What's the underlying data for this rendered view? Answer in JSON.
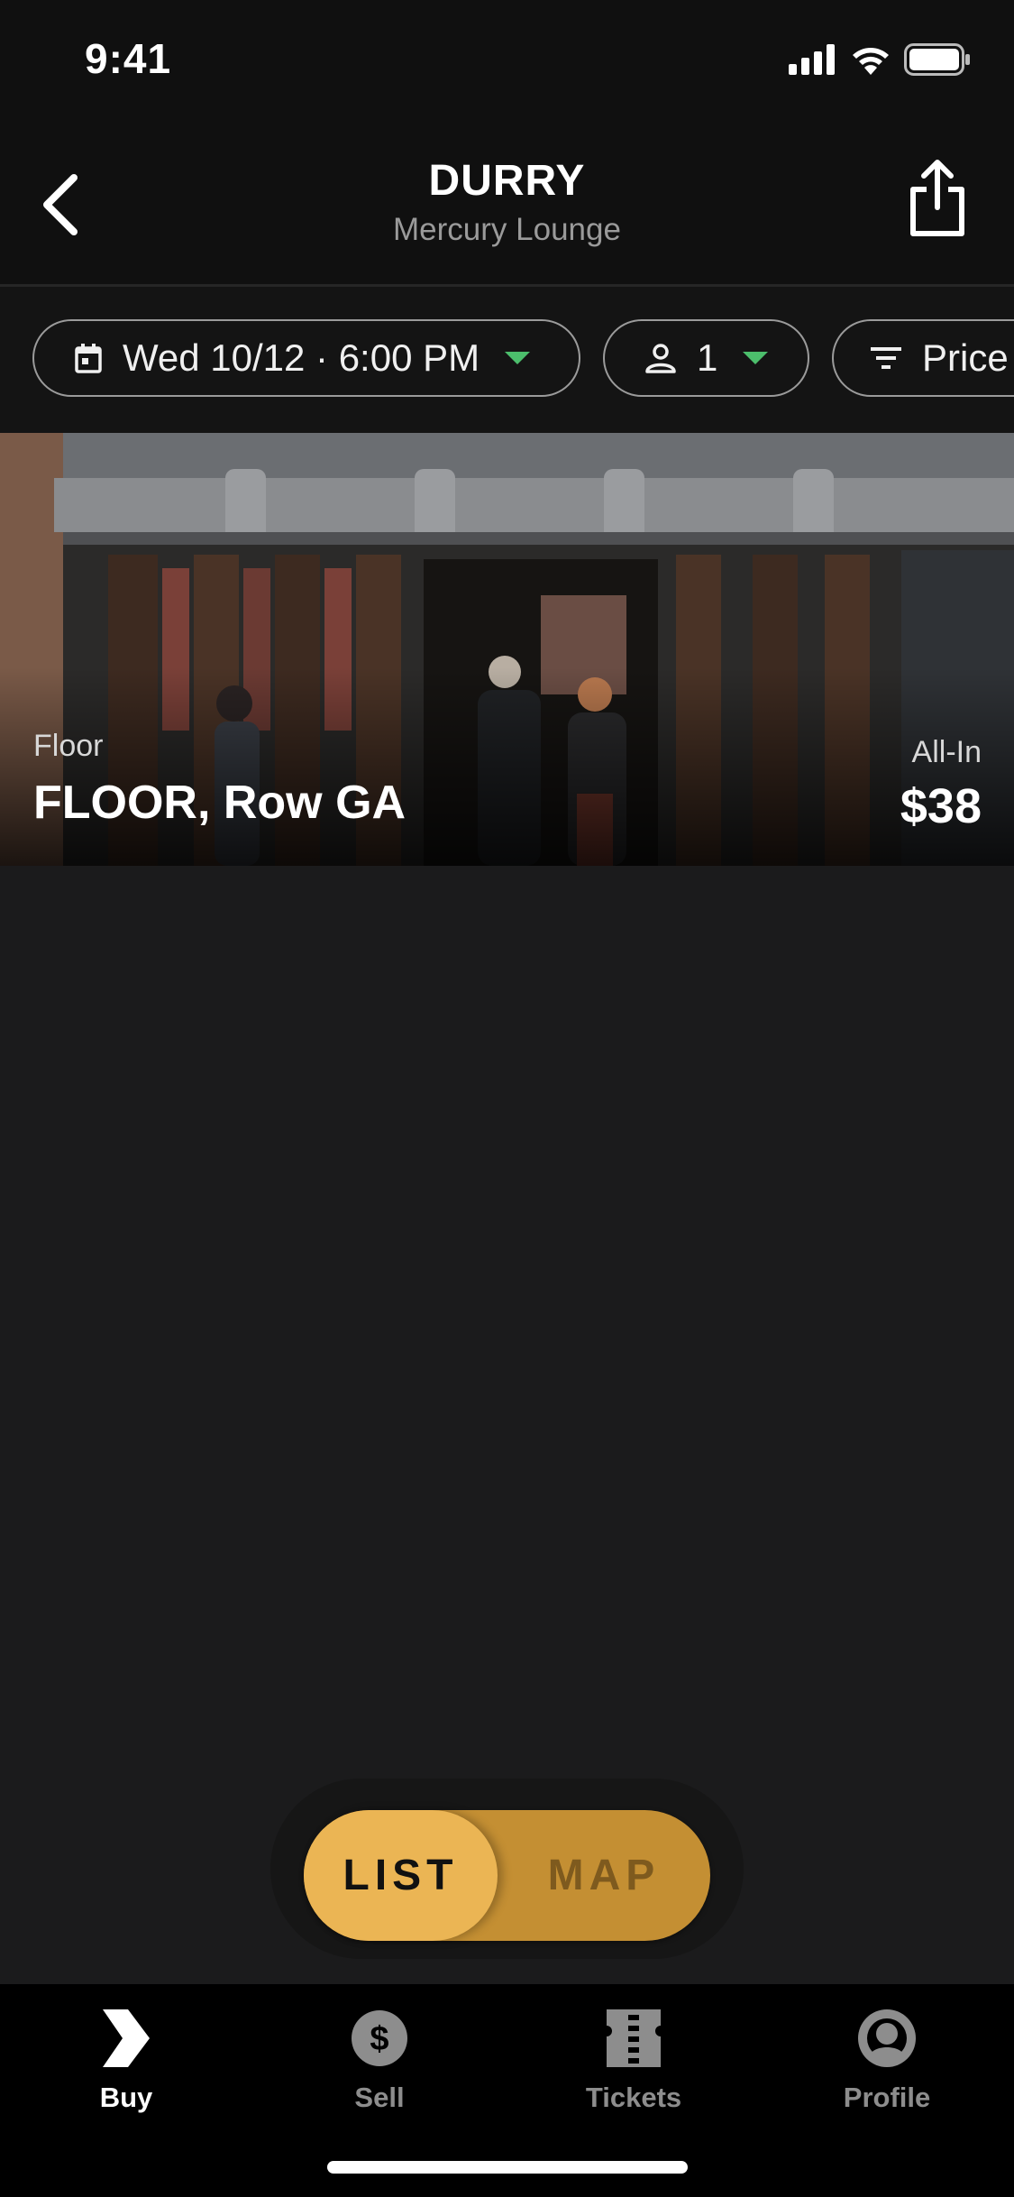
{
  "status_bar": {
    "time": "9:41"
  },
  "header": {
    "title": "DURRY",
    "subtitle": "Mercury Lounge"
  },
  "filters": {
    "date_chip": "Wed 10/12 · 6:00 PM",
    "quantity_chip": "1",
    "price_chip": "Price"
  },
  "listing": {
    "section": "Floor",
    "row": "FLOOR, Row GA",
    "price_label": "All-In",
    "price": "$38"
  },
  "view_toggle": {
    "list": "LIST",
    "map": "MAP",
    "selected": "LIST"
  },
  "tabbar": {
    "tabs": [
      {
        "label": "Buy",
        "icon": "buy-icon",
        "active": true
      },
      {
        "label": "Sell",
        "icon": "dollar-icon",
        "active": false
      },
      {
        "label": "Tickets",
        "icon": "ticket-icon",
        "active": false
      },
      {
        "label": "Profile",
        "icon": "profile-icon",
        "active": false
      }
    ]
  },
  "colors": {
    "accent_gold": "#ebb554",
    "toggle_gold_dark": "#c48f33",
    "caret_green": "#4cbe6c"
  }
}
